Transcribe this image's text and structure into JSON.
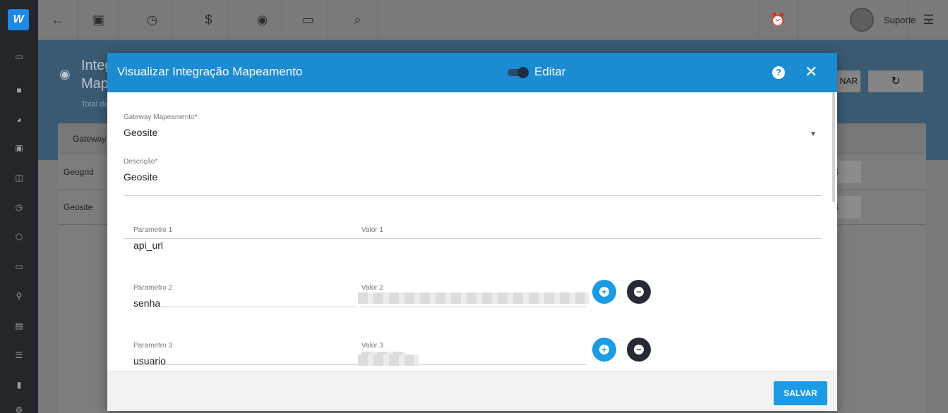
{
  "sidebar": {
    "logo_text": "W",
    "icons": [
      "book-icon",
      "dashboard-icon",
      "chart-pie-icon",
      "contact-icon",
      "card-icon",
      "calendar-icon",
      "box-icon",
      "payments-icon",
      "map-marker-icon",
      "list-icon",
      "server-icon",
      "document-icon",
      "settings-icon"
    ]
  },
  "topbar": {
    "icons": [
      "back-arrow-icon",
      "contact-card-icon",
      "calendar-clock-icon",
      "dollar-icon",
      "eye-icon",
      "terminal-icon",
      "search-icon"
    ],
    "user_name": "Suporte",
    "alarm_color": "#c62828"
  },
  "background": {
    "title_line1": "Integ",
    "title_line2": "Map",
    "subtitle": "Total de",
    "column_header": "Gateway",
    "rows": [
      "Geogrid",
      "Geosite"
    ],
    "row_button": "ES",
    "top_button_fragment": "NAR"
  },
  "modal": {
    "title": "Visualizar Integração Mapeamento",
    "toggle_label": "Editar",
    "help_symbol": "?",
    "close_symbol": "✕",
    "gateway": {
      "label": "Gateway Mapeamento",
      "required": "*",
      "value": "Geosite"
    },
    "description": {
      "label": "Descrição",
      "required": "*",
      "value": "Geosite"
    },
    "params": [
      {
        "param_label": "Parametro 1",
        "param_value": "api_url",
        "value_label": "Valor 1"
      },
      {
        "param_label": "Parametro 2",
        "param_value": "senha",
        "value_label": "Valor 2"
      },
      {
        "param_label": "Parametro 3",
        "param_value": "usuario",
        "value_label": "Valor 3"
      }
    ],
    "save_label": "SALVAR",
    "colors": {
      "header": "#1b8bd3",
      "accent": "#1b9ae6",
      "remove": "#262b33"
    }
  }
}
